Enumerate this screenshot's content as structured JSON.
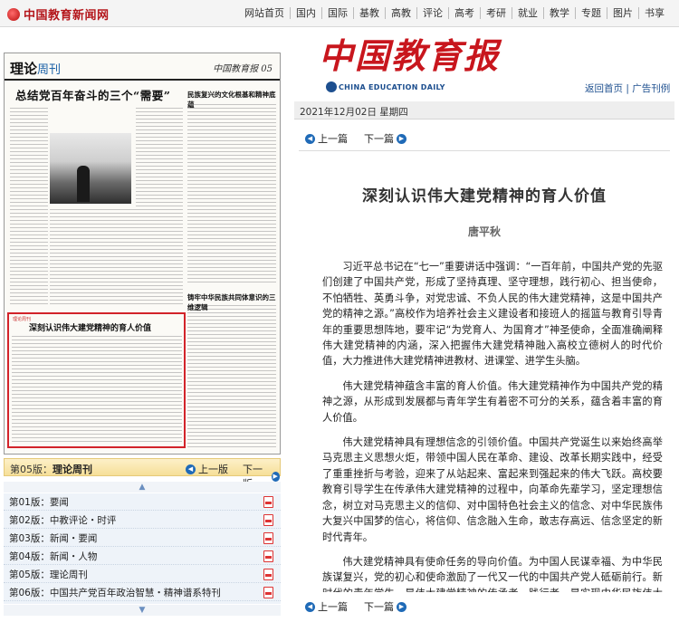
{
  "site": {
    "logo_text": "中国教育新闻网",
    "nav": [
      "网站首页",
      "国内",
      "国际",
      "基教",
      "高教",
      "评论",
      "高考",
      "考研",
      "就业",
      "教学",
      "专题",
      "图片",
      "书享"
    ]
  },
  "thumbnail": {
    "column_name": "理论",
    "column_name_suffix": "周刊",
    "paper_name": "中国教育报 05",
    "headline": "总结党百年奋斗的三个“需要”",
    "side_headline": "民族复兴的文化根基和精神底蕴",
    "side_headline2": "铸牢中华民族共同体意识的三维逻辑",
    "selected_tag": "理论周刊",
    "selected_title": "深刻认识伟大建党精神的育人价值"
  },
  "pagebar": {
    "current_label": "第05版：",
    "current_name": "理论周刊",
    "prev_label": "上一版",
    "next_label": "下一版"
  },
  "page_list": [
    {
      "label": "第01版：要闻"
    },
    {
      "label": "第02版：中教评论・时评"
    },
    {
      "label": "第03版：新闻・要闻"
    },
    {
      "label": "第04版：新闻・人物"
    },
    {
      "label": "第05版：理论周刊"
    },
    {
      "label": "第06版：中国共产党百年政治智慧・精神谱系特刊"
    }
  ],
  "masthead": {
    "title_zh": "中国教育报",
    "title_en": "CHINA EDUCATION DAILY"
  },
  "top_links": {
    "home": "返回首页",
    "ads": "广告刊例",
    "separator": " | "
  },
  "date_text": "2021年12月02日 星期四",
  "article_nav": {
    "prev": "上一篇",
    "next": "下一篇"
  },
  "article": {
    "title": "深刻认识伟大建党精神的育人价值",
    "author": "唐平秋",
    "paragraphs": [
      "习近平总书记在“七一”重要讲话中强调：“一百年前，中国共产党的先驱们创建了中国共产党，形成了坚持真理、坚守理想，践行初心、担当使命，不怕牺牲、英勇斗争，对党忠诚、不负人民的伟大建党精神，这是中国共产党的精神之源。”高校作为培养社会主义建设者和接班人的摇篮与教育引导青年的重要思想阵地，要牢记“为党育人、为国育才”神圣使命，全面准确阐释伟大建党精神的内涵，深入把握伟大建党精神融入高校立德树人的时代价值，大力推进伟大建党精神进教材、进课堂、进学生头脑。",
      "伟大建党精神蕴含丰富的育人价值。伟大建党精神作为中国共产党的精神之源，从形成到发展都与青年学生有着密不可分的关系，蕴含着丰富的育人价值。",
      "伟大建党精神具有理想信念的引领价值。中国共产党诞生以来始终高举马克思主义思想火炬，带领中国人民在革命、建设、改革长期实践中，经受了重重挫折与考验，迎来了从站起来、富起来到强起来的伟大飞跃。高校要教育引导学生在传承伟大建党精神的过程中，向革命先辈学习，坚定理想信念，树立对马克思主义的信仰、对中国特色社会主义的信念、对中华民族伟大复兴中国梦的信心，将信仰、信念融入生命，敢志存高远、信念坚定的新时代青年。",
      "伟大建党精神具有使命任务的导向价值。为中国人民谋幸福、为中华民族谋复兴，党的初心和使命激励了一代又一代的中国共产党人砥砺前行。新时代的青年学生，是伟大建党精神的传承者、践行者，是实现中华民族伟大复兴的先锋力量，理应将个人成长成才与国家前途、民族命运、人民幸福结合起来，切实增强报效祖国、为民服务的本领，自觉担负时代使命并为之不懈奋斗。"
    ]
  }
}
